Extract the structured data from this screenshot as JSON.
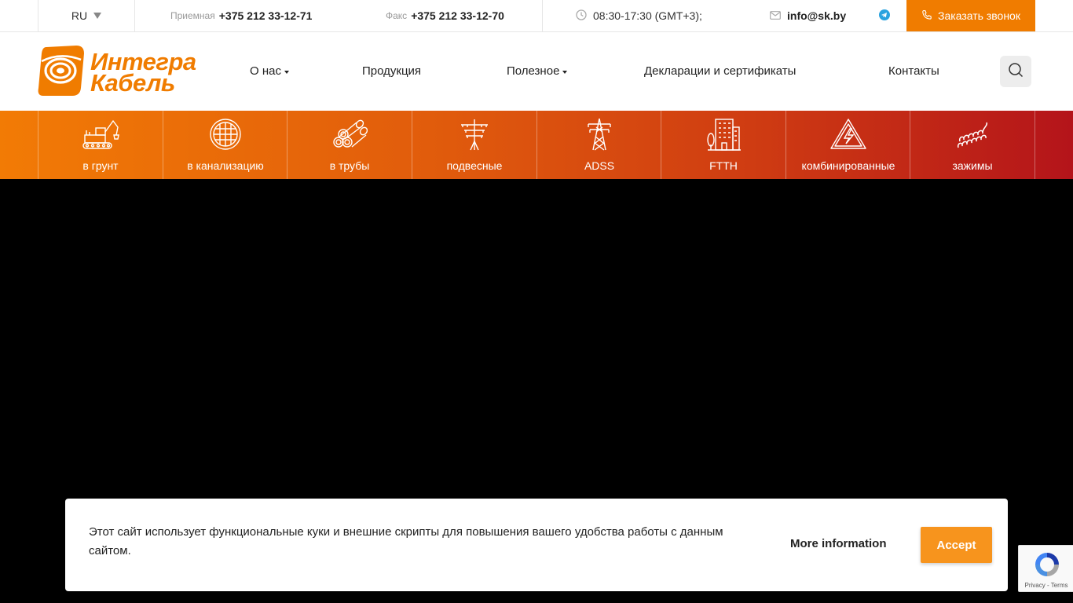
{
  "topbar": {
    "language": "RU",
    "reception_label": "Приемная",
    "reception_phone": "+375 212 33-12-71",
    "fax_label": "Факс",
    "fax_phone": "+375 212 33-12-70",
    "hours": "08:30-17:30 (GMT+3);",
    "email": "info@sk.by",
    "callback_label": "Заказать звонок"
  },
  "header": {
    "logo_line1": "Интегра",
    "logo_line2": "Кабель",
    "nav": [
      {
        "label": "О нас"
      },
      {
        "label": "Продукция"
      },
      {
        "label": "Полезное"
      },
      {
        "label": "Декларации и сертификаты"
      },
      {
        "label": "Контакты"
      }
    ]
  },
  "categories": [
    {
      "label": "в грунт",
      "icon": "excavator-icon"
    },
    {
      "label": "в канализацию",
      "icon": "manhole-icon"
    },
    {
      "label": "в трубы",
      "icon": "pipes-icon"
    },
    {
      "label": "подвесные",
      "icon": "utility-pole-icon"
    },
    {
      "label": "ADSS",
      "icon": "power-tower-icon"
    },
    {
      "label": "FTTH",
      "icon": "building-icon"
    },
    {
      "label": "комбинированные",
      "icon": "high-voltage-icon"
    },
    {
      "label": "зажимы",
      "icon": "spiral-clamp-icon"
    }
  ],
  "cookie": {
    "text": "Этот сайт использует функциональные куки и внешние скрипты для повышения вашего удобства работы с данным сайтом.",
    "more_info": "More information",
    "accept": "Accept"
  },
  "recaptcha": {
    "privacy": "Privacy",
    "separator": "-",
    "terms": "Terms"
  },
  "colors": {
    "accent": "#f07c00",
    "gradient_start": "#f27b05",
    "gradient_end": "#b4141a"
  }
}
